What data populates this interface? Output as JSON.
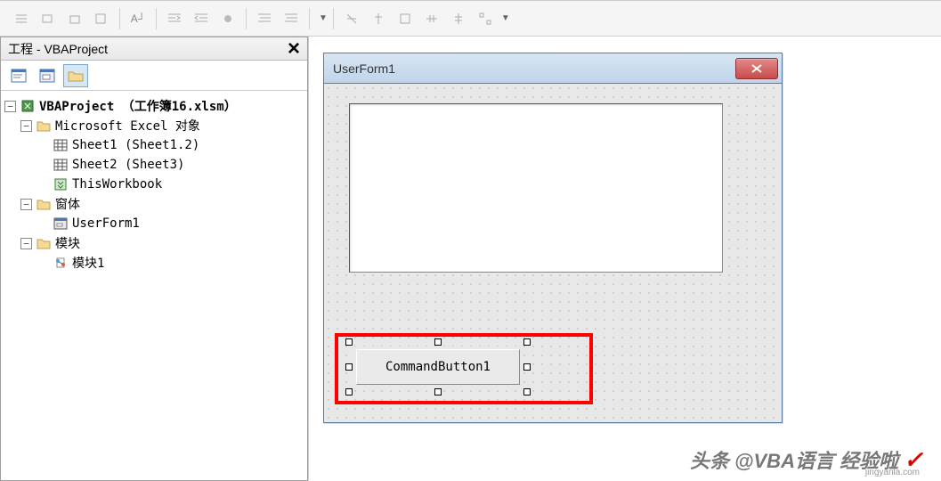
{
  "panel": {
    "title": "工程 - VBAProject"
  },
  "tree": {
    "root": "VBAProject （工作簿16.xlsm）",
    "excel_objects": "Microsoft Excel 对象",
    "sheet1": "Sheet1 (Sheet1.2)",
    "sheet2": "Sheet2 (Sheet3)",
    "workbook": "ThisWorkbook",
    "forms": "窗体",
    "userform": "UserForm1",
    "modules": "模块",
    "module1": "模块1"
  },
  "form": {
    "title": "UserForm1",
    "button_caption": "CommandButton1"
  },
  "watermark": {
    "text": "头条 @VBA语言 经验啦",
    "sub": "jingyanla.com"
  }
}
